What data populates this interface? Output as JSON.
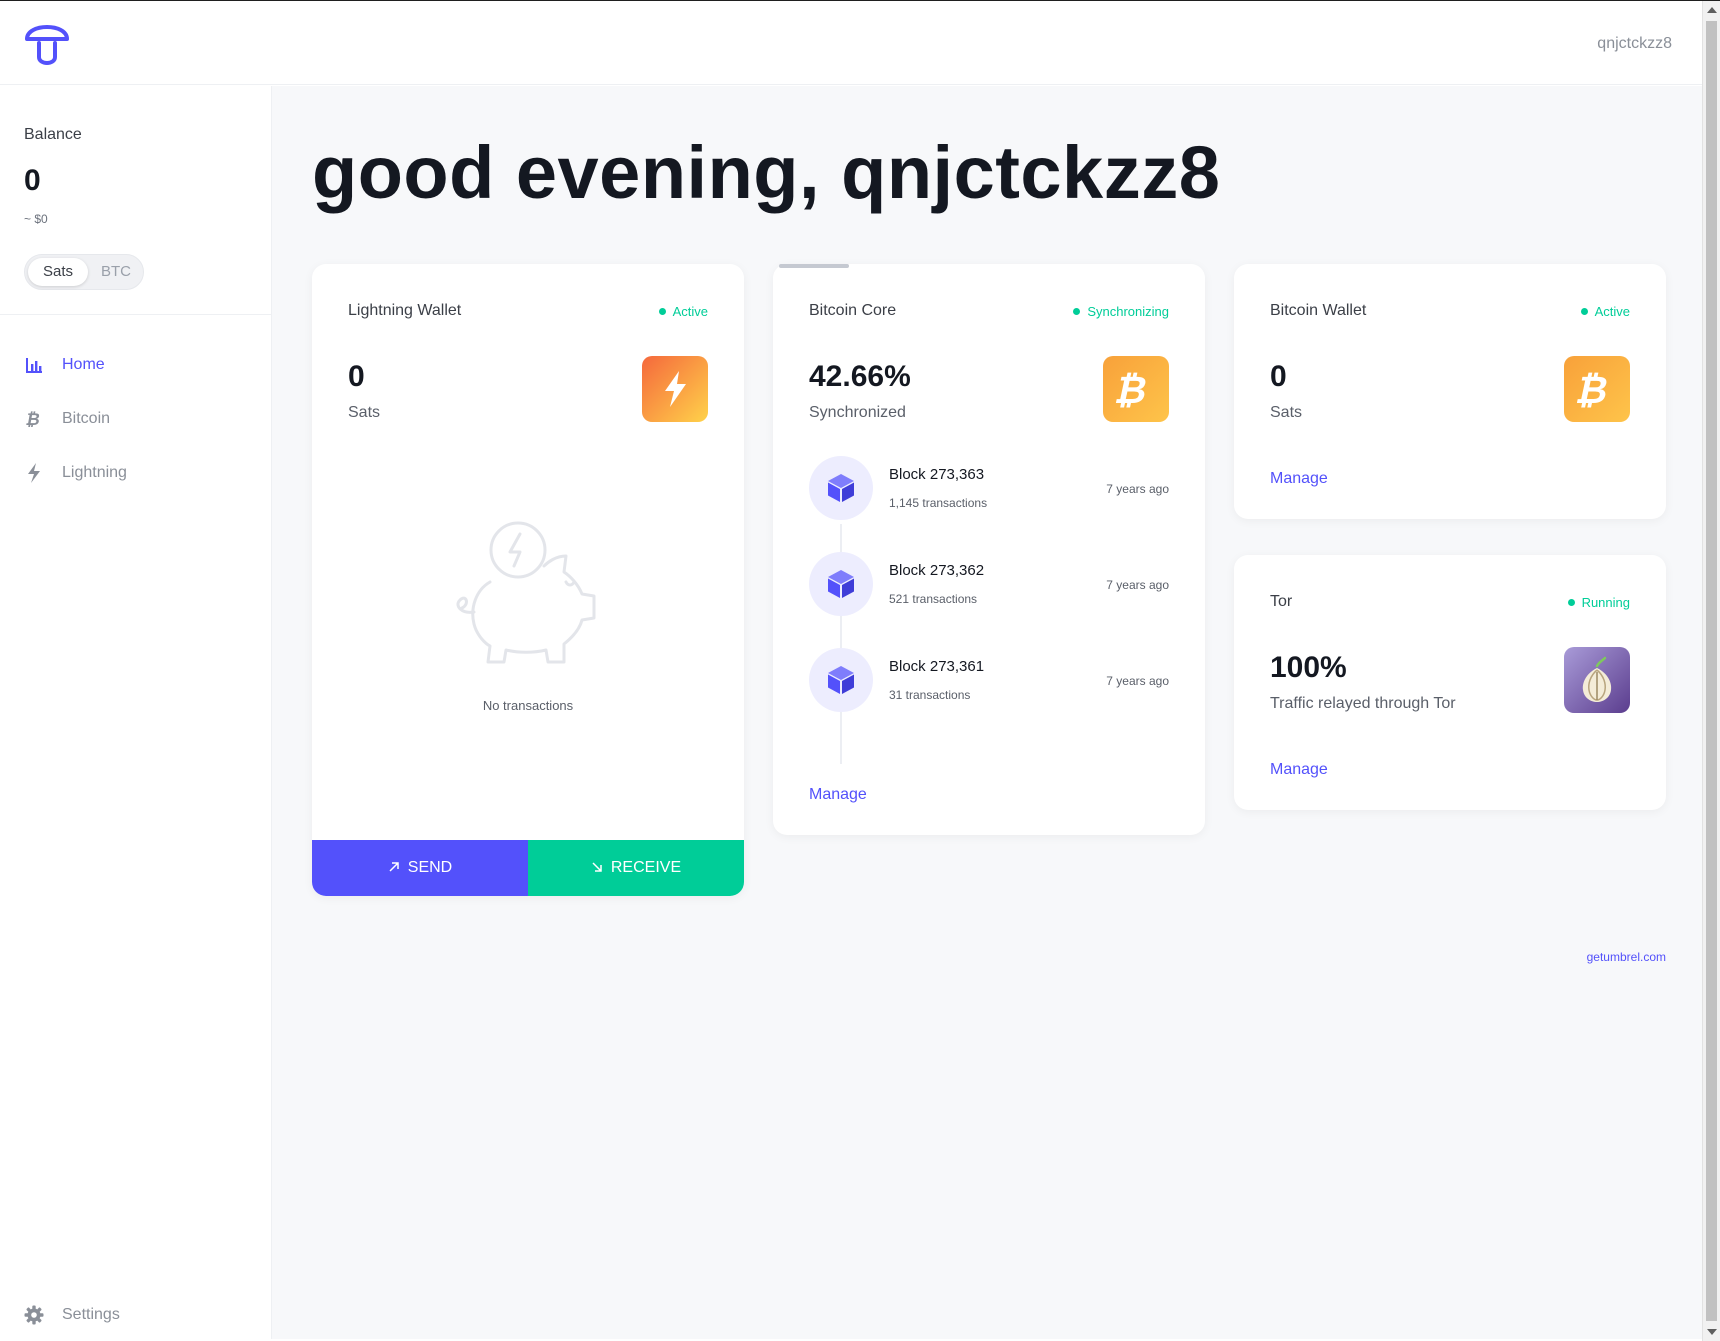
{
  "header": {
    "username": "qnjctckzz8"
  },
  "sidebar": {
    "balance_label": "Balance",
    "balance_value": "0",
    "balance_fiat": "~ $0",
    "unit_options": [
      "Sats",
      "BTC"
    ],
    "unit_selected": "Sats",
    "nav": [
      {
        "label": "Home",
        "icon": "bar-chart-icon",
        "active": true
      },
      {
        "label": "Bitcoin",
        "icon": "bitcoin-icon",
        "active": false
      },
      {
        "label": "Lightning",
        "icon": "lightning-icon",
        "active": false
      }
    ],
    "settings_label": "Settings"
  },
  "main": {
    "greeting": "good evening, qnjctckzz8",
    "lightning_wallet": {
      "title": "Lightning Wallet",
      "status": "Active",
      "balance": "0",
      "unit": "Sats",
      "empty_text": "No transactions",
      "send_label": "SEND",
      "receive_label": "RECEIVE"
    },
    "bitcoin_core": {
      "title": "Bitcoin Core",
      "status": "Synchronizing",
      "sync_percent": "42.66%",
      "sync_label": "Synchronized",
      "blocks": [
        {
          "name": "Block 273,363",
          "transactions": "1,145 transactions",
          "age": "7 years ago"
        },
        {
          "name": "Block 273,362",
          "transactions": "521 transactions",
          "age": "7 years ago"
        },
        {
          "name": "Block 273,361",
          "transactions": "31 transactions",
          "age": "7 years ago"
        }
      ],
      "manage_label": "Manage"
    },
    "bitcoin_wallet": {
      "title": "Bitcoin Wallet",
      "status": "Active",
      "balance": "0",
      "unit": "Sats",
      "manage_label": "Manage"
    },
    "tor": {
      "title": "Tor",
      "status": "Running",
      "percent": "100%",
      "label": "Traffic relayed through Tor",
      "manage_label": "Manage"
    },
    "footer_link": "getumbrel.com"
  },
  "colors": {
    "accent": "#5351fb",
    "success": "#00cd98",
    "text_dark": "#141821",
    "background": "#f7f8fa"
  }
}
